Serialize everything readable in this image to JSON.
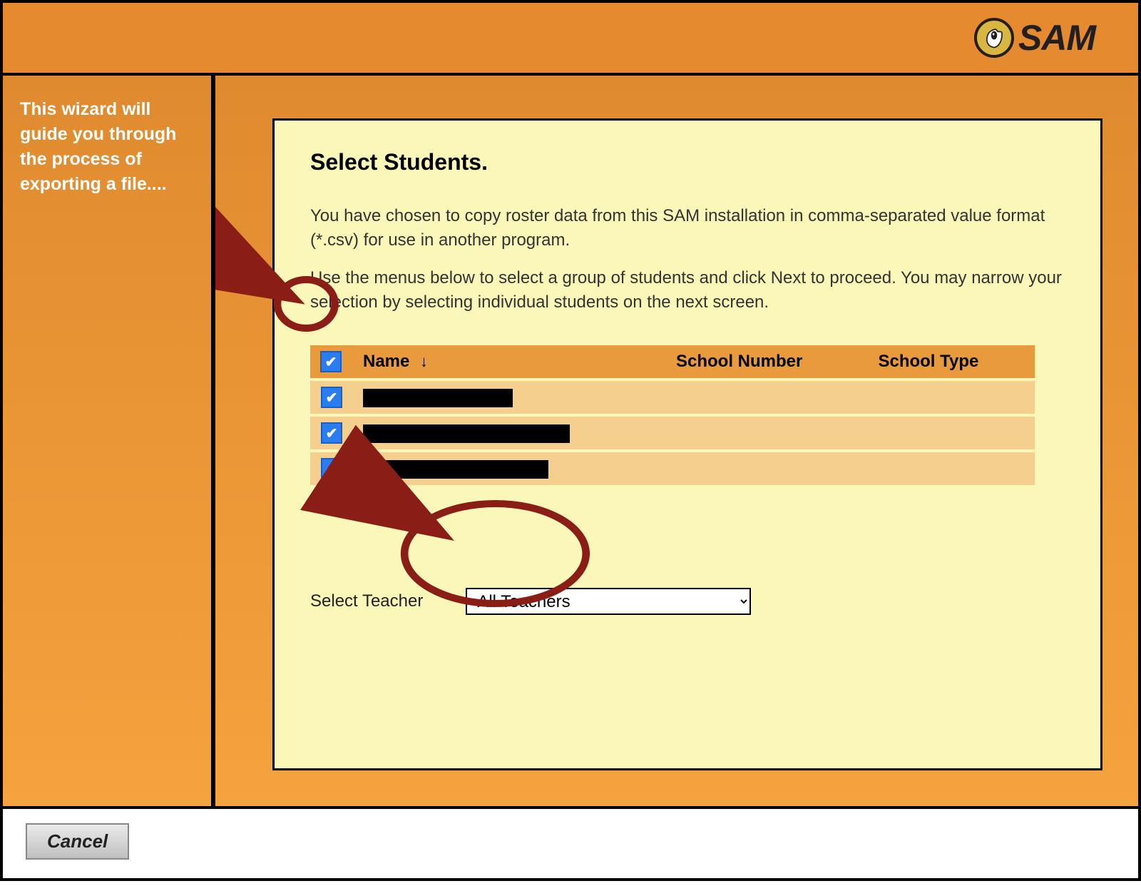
{
  "logo_text": "SAM",
  "sidebar": {
    "help_text": "This wizard will guide you through the process of exporting a file...."
  },
  "panel": {
    "title": "Select Students.",
    "intro1": "You have chosen to copy roster data from this SAM installation in comma-separated value format (*.csv) for use in another program.",
    "intro2": "Use the menus below to select a group of students and click Next to proceed. You may narrow your selection by selecting individual students on the next screen."
  },
  "table": {
    "col_name": "Name",
    "col_school_number": "School Number",
    "col_school_type": "School Type",
    "sort_indicator": "↓",
    "rows": [
      {
        "checked": true,
        "redact_width": 210
      },
      {
        "checked": true,
        "redact_width": 290
      },
      {
        "checked": true,
        "redact_width": 260
      }
    ]
  },
  "teacher": {
    "label": "Select Teacher",
    "selected": "All Teachers"
  },
  "footer": {
    "cancel_label": "Cancel"
  },
  "colors": {
    "orange": "#e58a2e",
    "panel": "#fbf7b8",
    "annotation": "#8a1d15"
  }
}
